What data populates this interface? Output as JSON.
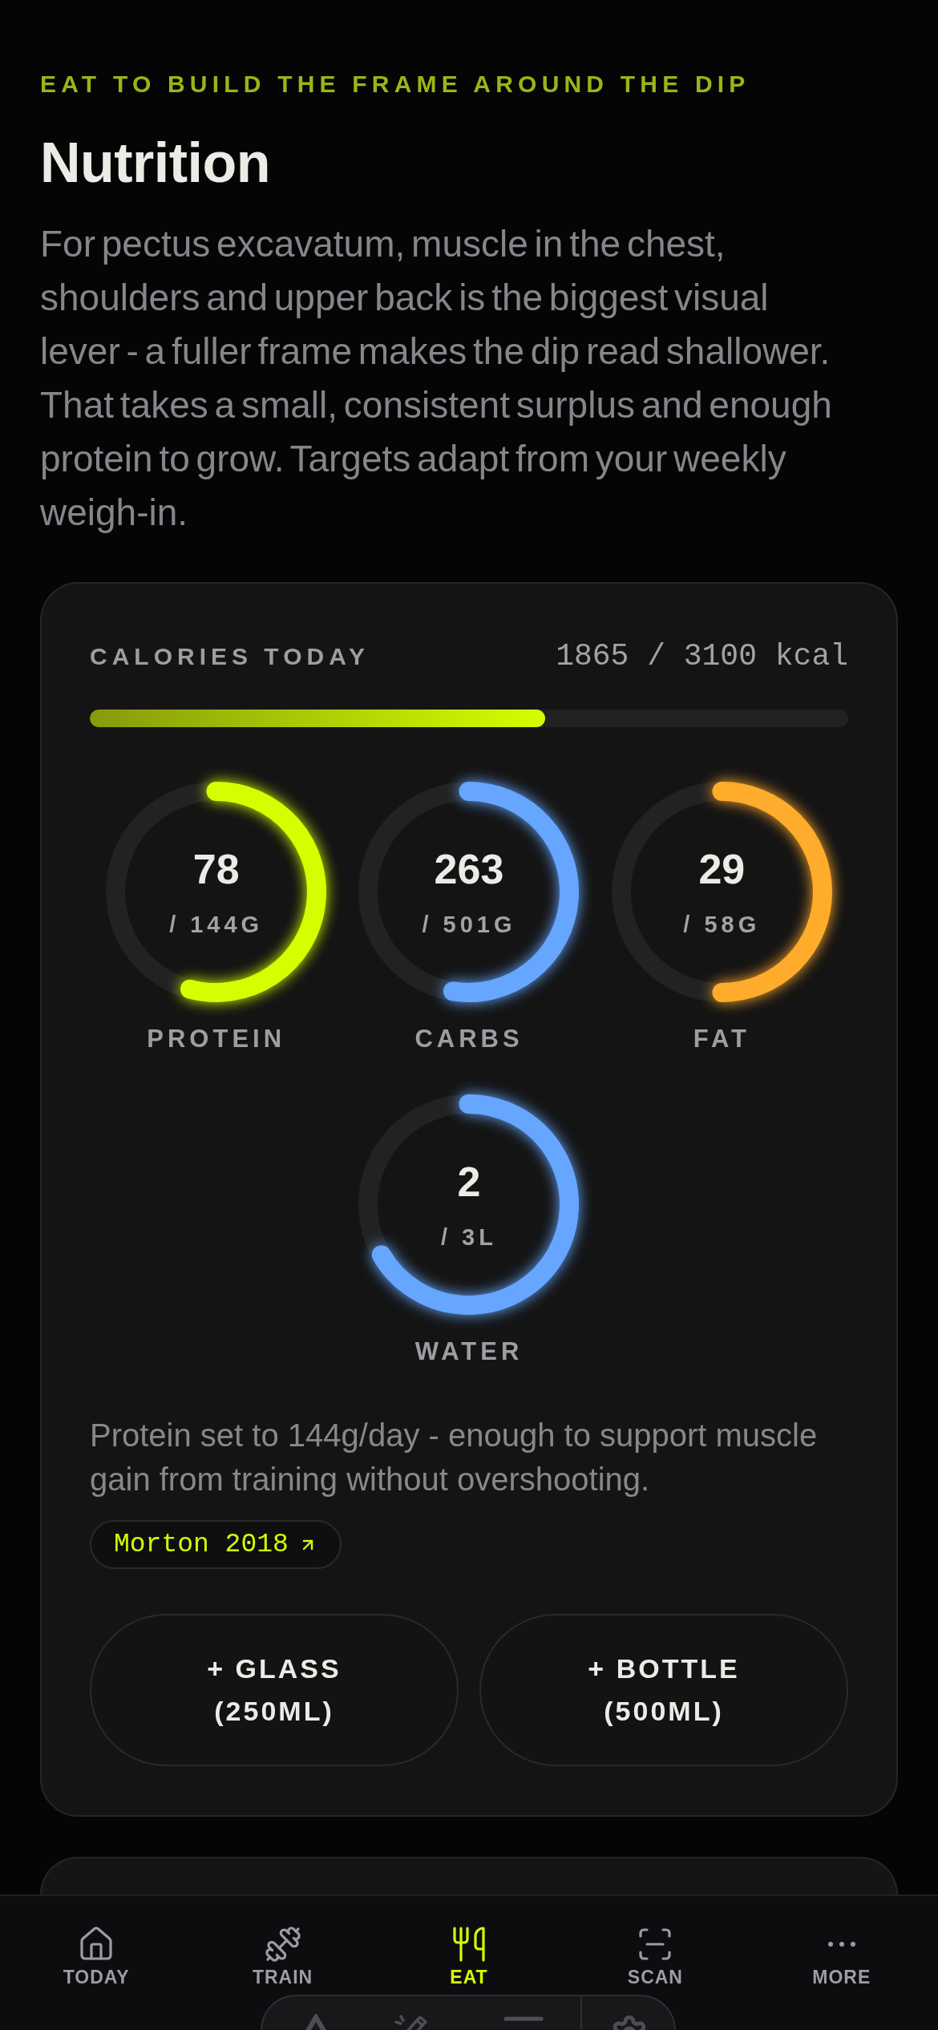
{
  "header": {
    "eyebrow": "EAT TO BUILD THE FRAME AROUND THE DIP",
    "title": "Nutrition",
    "intro": "For pectus excavatum, muscle in the chest, shoulders and upper back is the biggest visual lever - a fuller frame makes the dip read shallower. That takes a small, consistent surplus and enough protein to grow. Targets adapt from your weekly weigh-in."
  },
  "calories": {
    "label": "CALORIES TODAY",
    "reading": "1865 / 3100 kcal",
    "level": 0.6
  },
  "gauges": [
    {
      "label": "PROTEIN",
      "value": "78",
      "target": "/ 144G",
      "color": "#d4ff00"
    },
    {
      "label": "CARBS",
      "value": "263",
      "target": "/ 501G",
      "color": "#66a6ff"
    },
    {
      "label": "FAT",
      "value": "29",
      "target": "/ 58G",
      "color": "#ffab2b"
    },
    {
      "label": "WATER",
      "value": "2",
      "target": "/ 3L",
      "color": "#66a6ff"
    }
  ],
  "note": "Protein set to 144g/day - enough to support muscle gain from training without overshooting.",
  "citation": "Morton 2018",
  "buttons": [
    "+ GLASS (250ML)",
    "+ BOTTLE (500ML)"
  ],
  "nav": [
    {
      "label": "TODAY",
      "selected": false
    },
    {
      "label": "TRAIN",
      "selected": false
    },
    {
      "label": "EAT",
      "selected": true
    },
    {
      "label": "SCAN",
      "selected": false
    },
    {
      "label": "MORE",
      "selected": false
    }
  ]
}
